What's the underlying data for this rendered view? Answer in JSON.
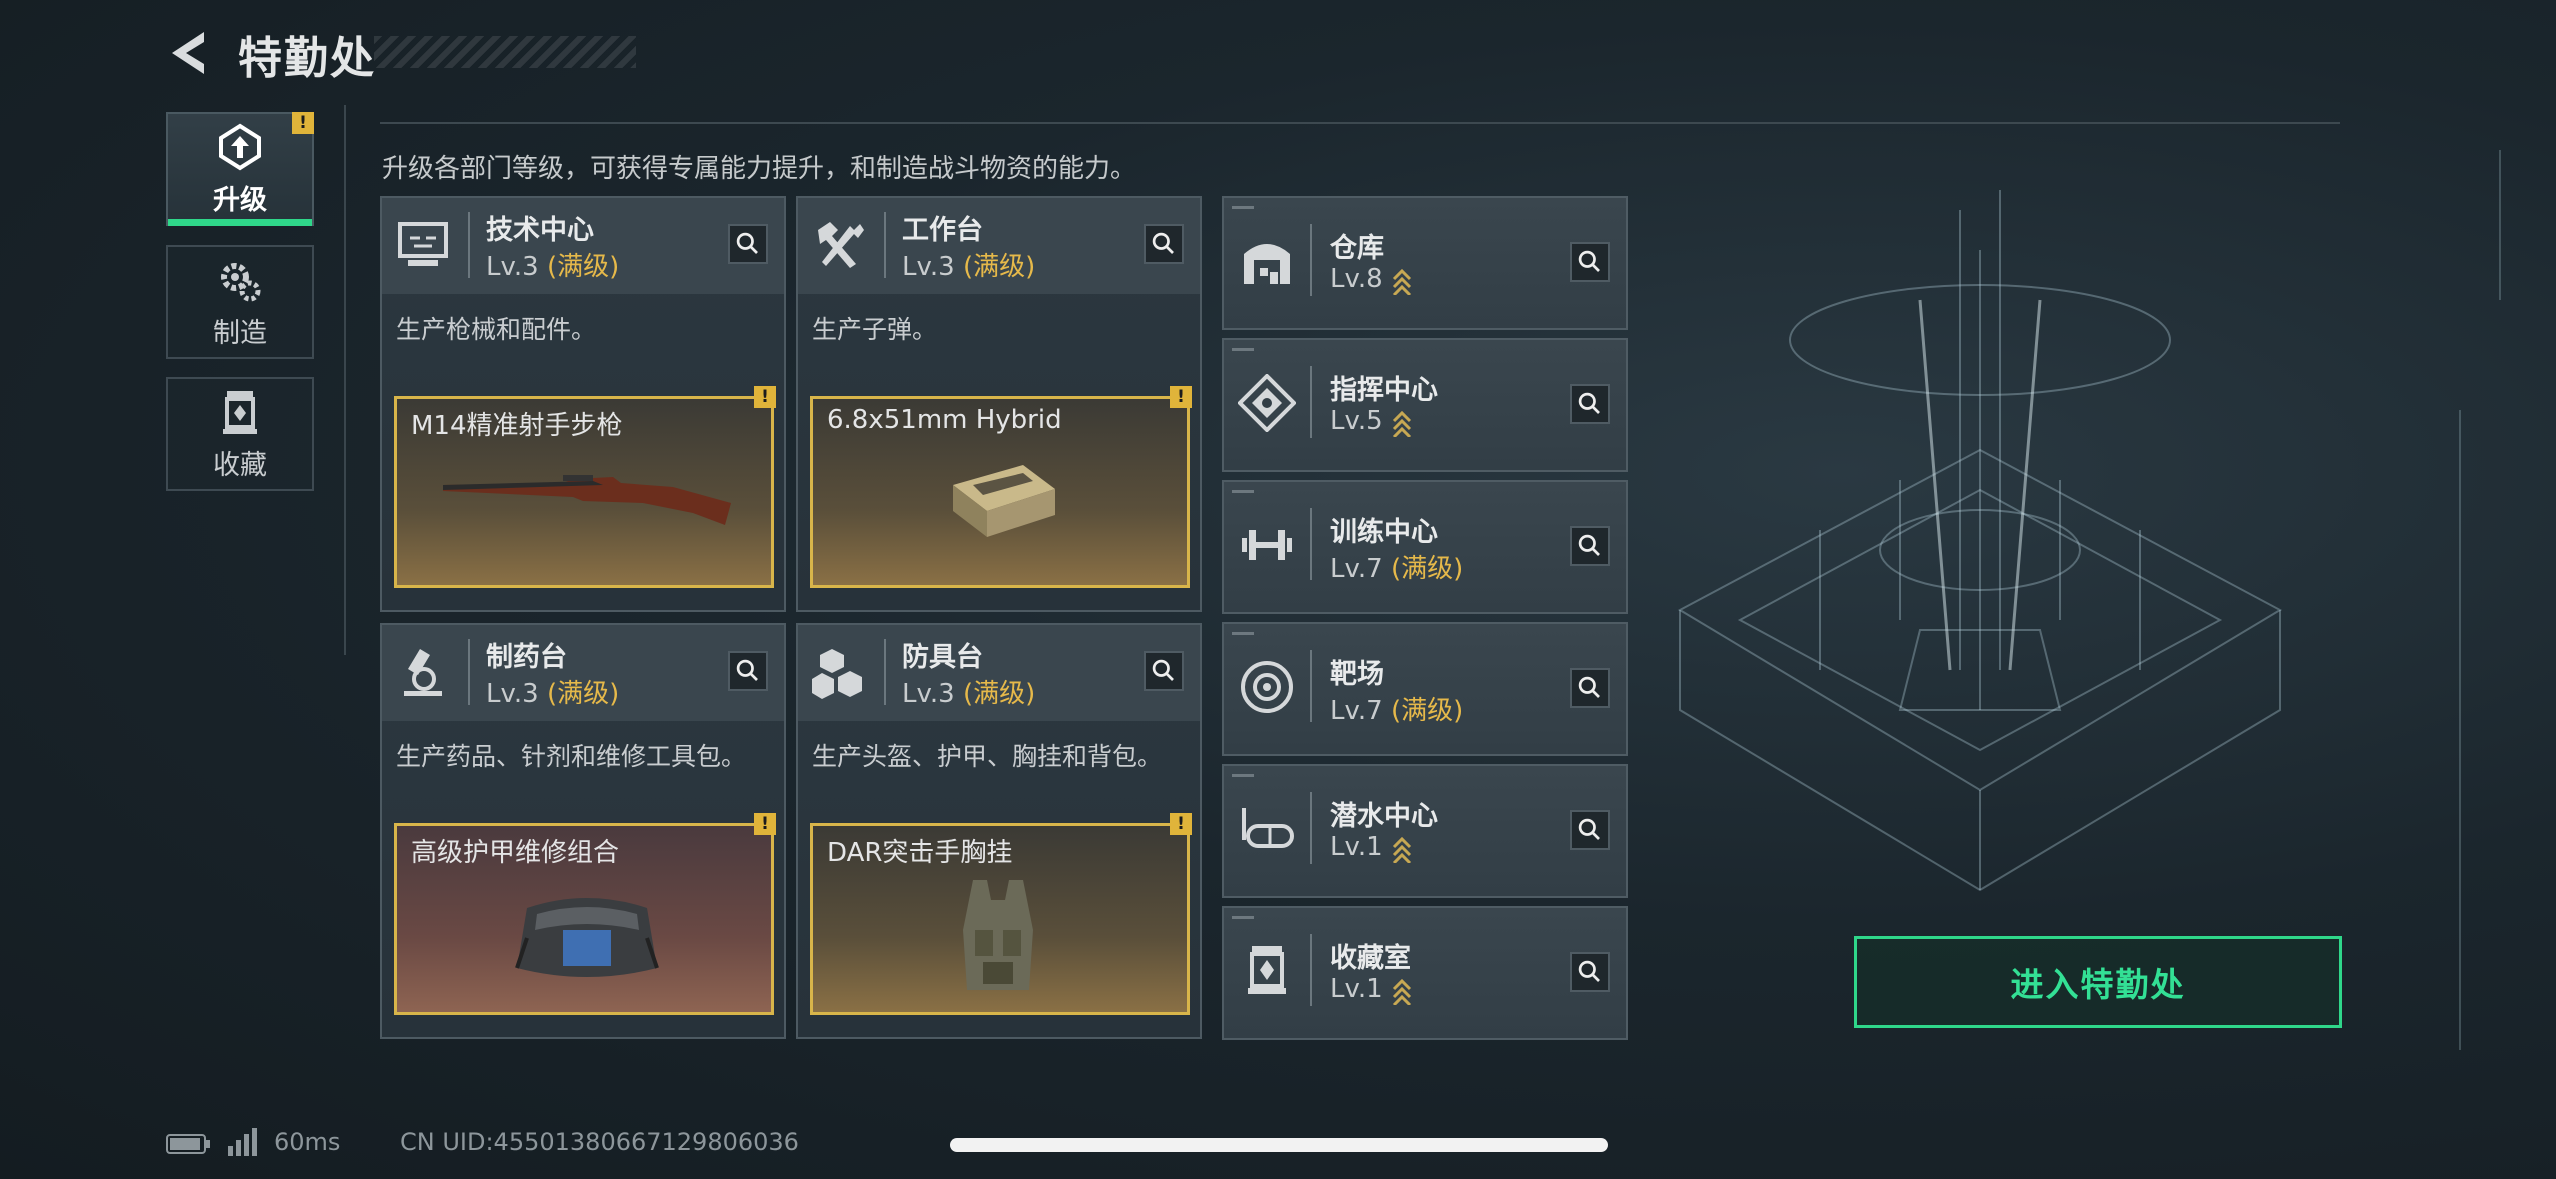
{
  "header": {
    "title": "特勤处"
  },
  "nav": [
    {
      "label": "升级",
      "icon": "upgrade-icon",
      "active": true,
      "warning": "!"
    },
    {
      "label": "制造",
      "icon": "gears-icon"
    },
    {
      "label": "收藏",
      "icon": "collection-icon"
    }
  ],
  "description": "升级各部门等级，可获得专属能力提升，和制造战斗物资的能力。",
  "departments": [
    {
      "name": "技术中心",
      "level": "Lv.3",
      "max": "(满级)",
      "desc": "生产枪械和配件。",
      "item": "M14精准射手步枪",
      "warning": "!",
      "icon": "computer-icon"
    },
    {
      "name": "工作台",
      "level": "Lv.3",
      "max": "(满级)",
      "desc": "生产子弹。",
      "item": "6.8x51mm Hybrid",
      "warning": "!",
      "icon": "tools-icon"
    },
    {
      "name": "制药台",
      "level": "Lv.3",
      "max": "(满级)",
      "desc": "生产药品、针剂和维修工具包。",
      "item": "高级护甲维修组合",
      "warning": "!",
      "icon": "microscope-icon"
    },
    {
      "name": "防具台",
      "level": "Lv.3",
      "max": "(满级)",
      "desc": "生产头盔、护甲、胸挂和背包。",
      "item": "DAR突击手胸挂",
      "warning": "!",
      "icon": "armor-blocks-icon"
    }
  ],
  "facilities": [
    {
      "name": "仓库",
      "level": "Lv.8",
      "max": "",
      "icon": "warehouse-icon"
    },
    {
      "name": "指挥中心",
      "level": "Lv.5",
      "max": "",
      "icon": "command-icon"
    },
    {
      "name": "训练中心",
      "level": "Lv.7",
      "max": "(满级)",
      "icon": "dumbbell-icon"
    },
    {
      "name": "靶场",
      "level": "Lv.7",
      "max": "(满级)",
      "icon": "target-icon"
    },
    {
      "name": "潜水中心",
      "level": "Lv.1",
      "max": "",
      "icon": "diving-mask-icon"
    },
    {
      "name": "收藏室",
      "level": "Lv.1",
      "max": "",
      "icon": "display-case-icon"
    }
  ],
  "enter_button": "进入特勤处",
  "status": {
    "ping": "60ms",
    "uid": "CN UID:4550138066712980​6036"
  },
  "colors": {
    "accent_green": "#2fd78a",
    "gold": "#e6b94a",
    "warning": "#e0b43a"
  }
}
